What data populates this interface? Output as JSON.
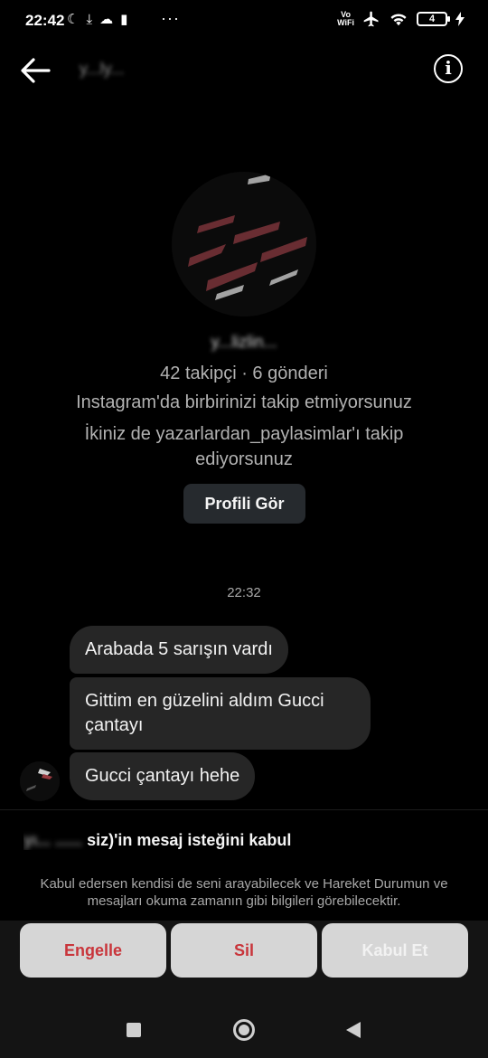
{
  "status_bar": {
    "time": "22:42",
    "dots": "···",
    "network_label": "Vo\nWiFi",
    "network_top": "Vo",
    "network_bottom": "WiFi",
    "battery_level": "4"
  },
  "header": {
    "name_obscured": "y...ly...",
    "back_icon": "back-arrow-icon",
    "info_icon": "info-icon"
  },
  "profile": {
    "name_obscured": "y...lizlin...",
    "stats": "42 takipçi · 6 gönderi",
    "follow_status": "Instagram'da birbirinizi takip etmiyorsunuz",
    "mutual": "İkiniz de yazarlardan_paylasimlar'ı takip ediyorsunuz",
    "view_profile_label": "Profili Gör"
  },
  "conversation": {
    "timestamp": "22:32",
    "messages": [
      "Arabada 5 sarışın vardı",
      "Gittim en güzelini aldım Gucci çantayı",
      "Gucci çantayı hehe"
    ]
  },
  "request": {
    "title_prefix_obscured": "yı...",
    "title_middle_obscured": "......",
    "title_suffix": "siz)'in mesaj isteğini kabul",
    "description": "Kabul edersen kendisi de seni arayabilecek ve Hareket Durumun ve mesajları okuma zamanın gibi bilgileri görebilecektir.",
    "block_label": "Engelle",
    "delete_label": "Sil",
    "accept_label": "Kabul Et"
  },
  "colors": {
    "background": "#000000",
    "bubble": "#262626",
    "danger": "#c9353b",
    "button_bg": "#d6d6d6",
    "profile_button": "#262a2e"
  }
}
